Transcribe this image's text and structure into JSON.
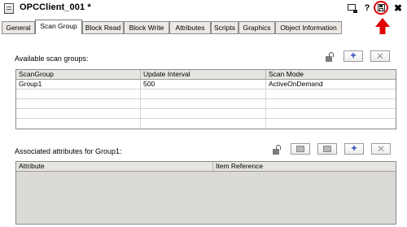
{
  "window": {
    "title": "OPCClient_001 *",
    "buttons": {
      "dock": "dock-window-icon",
      "help": "?",
      "save": "save-icon",
      "close": "✖"
    }
  },
  "tabs": [
    {
      "label": "General"
    },
    {
      "label": "Scan Group"
    },
    {
      "label": "Block Read"
    },
    {
      "label": "Block Write"
    },
    {
      "label": "Attributes"
    },
    {
      "label": "Scripts"
    },
    {
      "label": "Graphics"
    },
    {
      "label": "Object Information"
    }
  ],
  "active_tab": "Scan Group",
  "scan_groups": {
    "label": "Available scan groups:",
    "add_label": "+",
    "delete_label": "✕",
    "columns": [
      "ScanGroup",
      "Update Interval",
      "Scan Mode"
    ],
    "rows": [
      [
        "Group1",
        "500",
        "ActiveOnDemand"
      ]
    ]
  },
  "attributes": {
    "label": "Associated attributes for Group1:",
    "add_label": "+",
    "delete_label": "✕",
    "columns": [
      "Attribute",
      "Item Reference"
    ]
  },
  "colors": {
    "highlight": "#e00000",
    "add_button": "#1b3fb8"
  }
}
